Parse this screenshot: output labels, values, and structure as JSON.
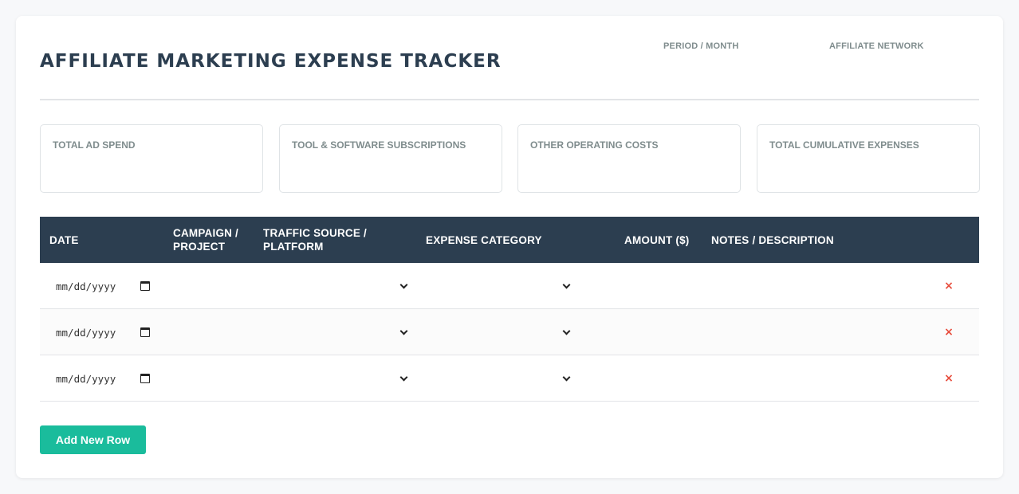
{
  "header": {
    "title": "AFFILIATE MARKETING EXPENSE TRACKER",
    "period_label": "PERIOD / MONTH",
    "network_label": "AFFILIATE NETWORK"
  },
  "summary": [
    {
      "label": "TOTAL AD SPEND",
      "value": ""
    },
    {
      "label": "TOOL & SOFTWARE SUBSCRIPTIONS",
      "value": ""
    },
    {
      "label": "OTHER OPERATING COSTS",
      "value": ""
    },
    {
      "label": "TOTAL CUMULATIVE EXPENSES",
      "value": ""
    }
  ],
  "table": {
    "columns": {
      "date": "DATE",
      "campaign": "CAMPAIGN / PROJECT",
      "traffic": "TRAFFIC SOURCE / PLATFORM",
      "category": "EXPENSE CATEGORY",
      "amount": "AMOUNT ($)",
      "notes": "NOTES / DESCRIPTION"
    },
    "rows": [
      {
        "date": "mm/dd/yyyy",
        "delete": "×"
      },
      {
        "date": "mm/dd/yyyy",
        "delete": "×"
      },
      {
        "date": "mm/dd/yyyy",
        "delete": "×"
      }
    ]
  },
  "actions": {
    "add_row": "Add New Row"
  },
  "colors": {
    "header_bg": "#2c3e50",
    "accent": "#1abc9c",
    "delete": "#e74c3c"
  },
  "icons": {
    "date": "calendar-icon",
    "select": "chevron-down-icon",
    "delete": "close-icon"
  }
}
